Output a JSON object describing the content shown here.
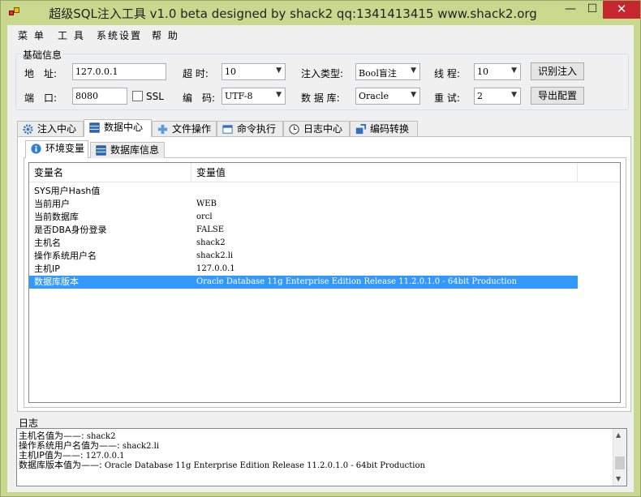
{
  "window": {
    "title": "超级SQL注入工具 v1.0 beta designed by shack2 qq:1341413415 www.shack2.org",
    "minimize": "—",
    "maximize": "☐",
    "close": "✕"
  },
  "menu": [
    "菜 单",
    "工 具",
    "系统设置",
    "帮 助"
  ],
  "basic_info": {
    "group_title": "基础信息",
    "address_label": "地　址:",
    "address_value": "127.0.0.1",
    "port_label": "端　口:",
    "port_value": "8080",
    "ssl_label": "SSL",
    "timeout_label": "超 时:",
    "timeout_value": "10",
    "encoding_label": "编　码:",
    "encoding_value": "UTF-8",
    "inject_type_label": "注入类型:",
    "inject_type_value": "Bool盲注",
    "database_label": "数 据 库:",
    "database_value": "Oracle",
    "threads_label": "线 程:",
    "threads_value": "10",
    "retry_label": "重 试:",
    "retry_value": "2",
    "identify_button": "识别注入",
    "export_button": "导出配置"
  },
  "tabs": [
    {
      "label": "注入中心",
      "icon": "gear-icon"
    },
    {
      "label": "数据中心",
      "icon": "database-icon"
    },
    {
      "label": "文件操作",
      "icon": "file-icon"
    },
    {
      "label": "命令执行",
      "icon": "terminal-icon"
    },
    {
      "label": "日志中心",
      "icon": "log-icon"
    },
    {
      "label": "编码转换",
      "icon": "convert-icon"
    }
  ],
  "subtabs": [
    {
      "label": "环境变量",
      "icon": "info-icon"
    },
    {
      "label": "数据库信息",
      "icon": "database-icon"
    }
  ],
  "table": {
    "columns": [
      "变量名",
      "变量值"
    ],
    "rows": [
      {
        "name": "SYS用户Hash值",
        "value": ""
      },
      {
        "name": "当前用户",
        "value": "WEB"
      },
      {
        "name": "当前数据库",
        "value": "orcl"
      },
      {
        "name": "是否DBA身份登录",
        "value": "FALSE"
      },
      {
        "name": "主机名",
        "value": "shack2"
      },
      {
        "name": "操作系统用户名",
        "value": "shack2.li"
      },
      {
        "name": "主机IP",
        "value": "127.0.0.1"
      },
      {
        "name": "数据库版本",
        "value": "Oracle Database 11g Enterprise Edition Release 11.2.0.1.0 - 64bit Production"
      }
    ],
    "selected_index": 7
  },
  "log": {
    "label": "日志",
    "lines": [
      {
        "key": "主机名值为——:",
        "val": " shack2"
      },
      {
        "key": "操作系统用户名值为——:",
        "val": " shack2.li"
      },
      {
        "key": "主机IP值为——:",
        "val": " 127.0.0.1"
      },
      {
        "key": "数据库版本值为——:",
        "val": " Oracle Database 11g Enterprise Edition Release 11.2.0.1.0 - 64bit Production"
      }
    ]
  }
}
